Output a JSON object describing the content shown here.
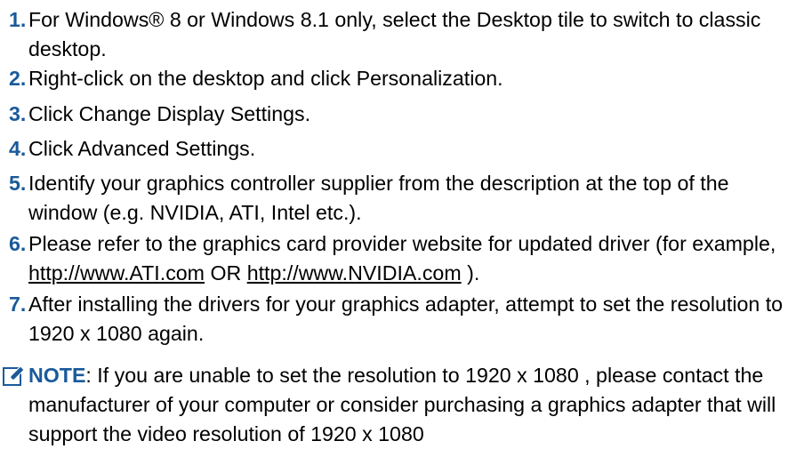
{
  "steps": [
    {
      "num": "1.",
      "text": "For Windows® 8 or Windows 8.1 only, select the Desktop tile to switch to classic desktop."
    },
    {
      "num": "2.",
      "text": "Right-click on the desktop and click Personalization."
    },
    {
      "num": "3.",
      "text": "Click Change Display Settings."
    },
    {
      "num": "4.",
      "text": "Click Advanced Settings."
    },
    {
      "num": "5.",
      "text": "Identify your graphics controller supplier from the description at the top of the window (e.g. NVIDIA, ATI, Intel etc.)."
    },
    {
      "num": "6.",
      "text_before": "Please refer to the graphics card provider website for updated driver (for example,",
      "link1": "http://www.ATI.com",
      "text_mid": "OR",
      "link2": "http://www.NVIDIA.com",
      "text_after": ")."
    },
    {
      "num": "7.",
      "text": "After installing the drivers for your graphics adapter, attempt to set the resolution to 1920 x 1080 again."
    }
  ],
  "note": {
    "icon": "pencil-icon",
    "label": "NOTE",
    "text": ": If you are unable to set the resolution to 1920 x 1080 , please contact the manufacturer of your computer or consider purchasing a graphics adapter that will support the video resolution of 1920 x 1080"
  },
  "colors": {
    "accent": "#1a5a9a",
    "text": "#000000",
    "background": "#ffffff"
  }
}
